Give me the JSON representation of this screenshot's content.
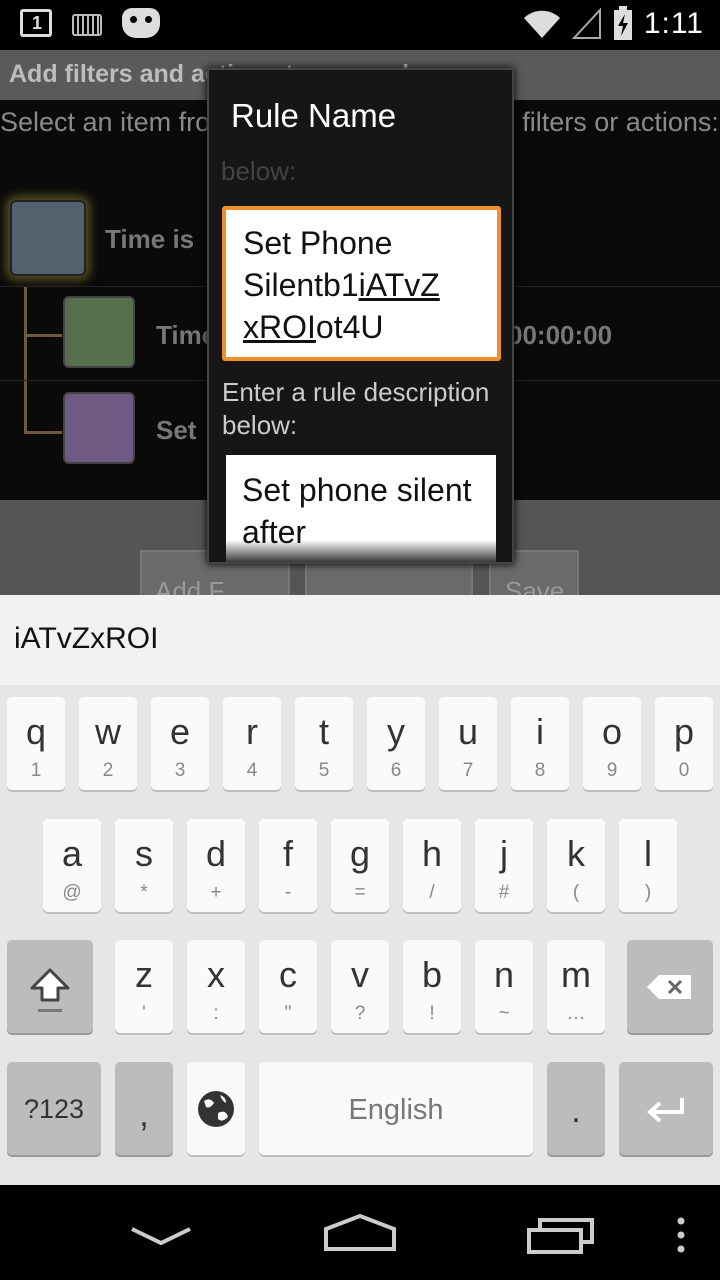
{
  "status_bar": {
    "notification_count": "1",
    "time": "1:11",
    "icons": [
      "notification-icon",
      "keyboard-icon",
      "cyanogenmod-icon",
      "wifi-icon",
      "signal-icon",
      "battery-charging-icon"
    ]
  },
  "app": {
    "title": "Add filters and actions to your rule",
    "description": "Select an item from the list below, then add filters or actions:",
    "tree": {
      "root_label": "Time is",
      "child1_label": "Time",
      "child1_value": "00:00:00",
      "child2_label": "Set"
    },
    "buttons": [
      "Add F",
      "Save"
    ]
  },
  "dialog": {
    "title": "Rule Name",
    "ghost_text": "below:",
    "name_value_part1": "Set Phone Silentb1",
    "name_value_underlined1": "iATvZ",
    "name_value_underlined2": "xROI",
    "name_value_part2": "ot4U",
    "desc_label": "Enter a rule description below:",
    "desc_value": "Set phone silent after"
  },
  "extracted_text": "iATvZxROI",
  "keyboard": {
    "row1": [
      {
        "k": "q",
        "s": "1"
      },
      {
        "k": "w",
        "s": "2"
      },
      {
        "k": "e",
        "s": "3"
      },
      {
        "k": "r",
        "s": "4"
      },
      {
        "k": "t",
        "s": "5"
      },
      {
        "k": "y",
        "s": "6"
      },
      {
        "k": "u",
        "s": "7"
      },
      {
        "k": "i",
        "s": "8"
      },
      {
        "k": "o",
        "s": "9"
      },
      {
        "k": "p",
        "s": "0"
      }
    ],
    "row2": [
      {
        "k": "a",
        "s": "@"
      },
      {
        "k": "s",
        "s": "*"
      },
      {
        "k": "d",
        "s": "+"
      },
      {
        "k": "f",
        "s": "-"
      },
      {
        "k": "g",
        "s": "="
      },
      {
        "k": "h",
        "s": "/"
      },
      {
        "k": "j",
        "s": "#"
      },
      {
        "k": "k",
        "s": "("
      },
      {
        "k": "l",
        "s": ")"
      }
    ],
    "row3": [
      {
        "k": "z",
        "s": "'"
      },
      {
        "k": "x",
        "s": ":"
      },
      {
        "k": "c",
        "s": "\""
      },
      {
        "k": "v",
        "s": "?"
      },
      {
        "k": "b",
        "s": "!"
      },
      {
        "k": "n",
        "s": "~"
      },
      {
        "k": "m",
        "s": "…"
      }
    ],
    "symbols_label": "?123",
    "comma_label": ",",
    "space_label": "English",
    "period_label": "."
  }
}
